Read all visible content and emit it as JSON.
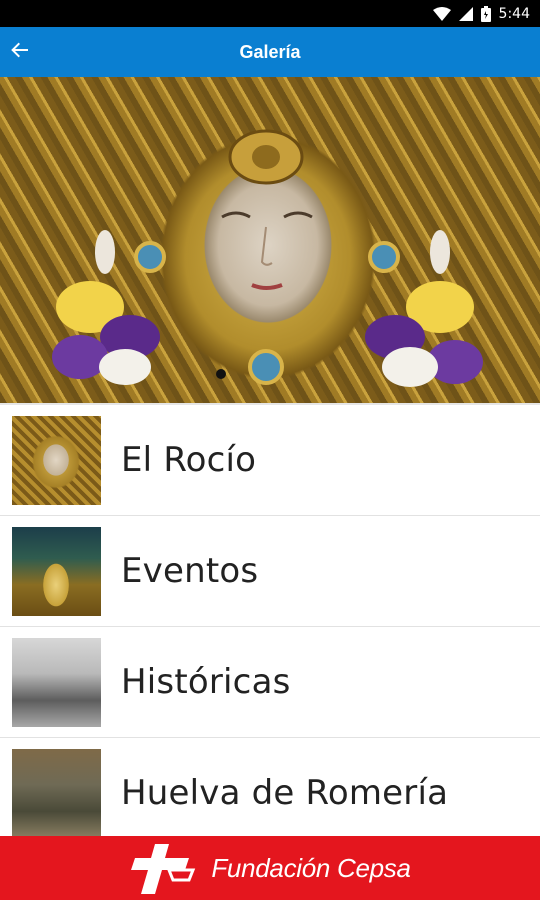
{
  "status_bar": {
    "time": "5:44",
    "icons": [
      "wifi-icon",
      "signal-icon",
      "battery-icon"
    ]
  },
  "app_bar": {
    "title": "Galería",
    "back_icon": "arrow-left-icon"
  },
  "hero": {
    "page_indicator": {
      "current": 1
    }
  },
  "gallery": {
    "items": [
      {
        "label": "El Rocío"
      },
      {
        "label": "Eventos"
      },
      {
        "label": "Históricas"
      },
      {
        "label": "Huelva de Romería"
      }
    ]
  },
  "footer": {
    "brand": "Fundación Cepsa",
    "logo_icon": "cepsa-logo-icon"
  },
  "colors": {
    "app_bar": "#0a7fd1",
    "footer": "#e4161e",
    "status_bar": "#000000"
  }
}
